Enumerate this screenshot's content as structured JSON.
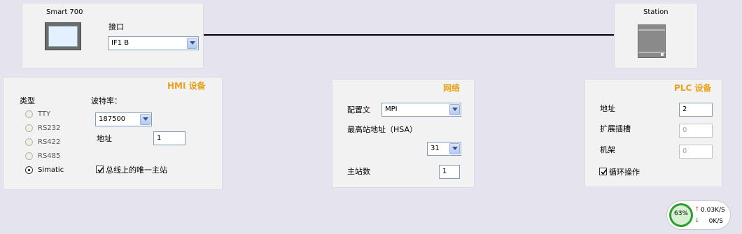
{
  "hmi_device": {
    "name": "Smart 700",
    "interface_label": "接口",
    "interface_value": "IF1 B"
  },
  "plc_station": {
    "name": "Station"
  },
  "hmi_settings": {
    "title": "HMI 设备",
    "type_label": "类型",
    "types": [
      "TTY",
      "RS232",
      "RS422",
      "RS485",
      "Simatic"
    ],
    "selected_type": "Simatic",
    "baud_label": "波特率：",
    "baud_value": "187500",
    "address_label": "地址",
    "address_value": "1",
    "only_master_label": "总线上的唯一主站",
    "only_master_checked": true
  },
  "network": {
    "title": "网络",
    "profile_label": "配置文",
    "profile_value": "MPI",
    "hsa_label": "最高站地址（HSA）",
    "hsa_value": "31",
    "masters_label": "主站数",
    "masters_value": "1"
  },
  "plc_settings": {
    "title": "PLC 设备",
    "address_label": "地址",
    "address_value": "2",
    "slot_label": "扩展插槽",
    "slot_value": "0",
    "rack_label": "机架",
    "rack_value": "0",
    "cyclic_label": "循环操作",
    "cyclic_checked": true
  },
  "net_monitor": {
    "percent": "63%",
    "up": "0.03K/S",
    "down": "0K/S",
    "up_color": "#e05a1a",
    "down_color": "#2e8b2e"
  }
}
